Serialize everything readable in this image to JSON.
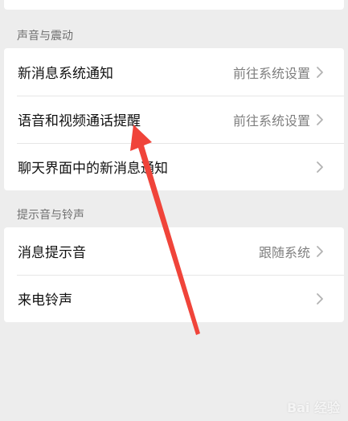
{
  "sections": [
    {
      "header": "声音与震动",
      "items": [
        {
          "label": "新消息系统通知",
          "value": "前往系统设置"
        },
        {
          "label": "语音和视频通话提醒",
          "value": "前往系统设置"
        },
        {
          "label": "聊天界面中的新消息通知",
          "value": ""
        }
      ]
    },
    {
      "header": "提示音与铃声",
      "items": [
        {
          "label": "消息提示音",
          "value": "跟随系统"
        },
        {
          "label": "来电铃声",
          "value": ""
        }
      ]
    }
  ],
  "icons": {
    "chevron": "chevron-right-icon",
    "annotation": "red-arrow-annotation"
  },
  "colors": {
    "background": "#ededed",
    "card": "#ffffff",
    "label": "#111111",
    "value": "#7f7f7f",
    "header": "#6f6f6f",
    "annotation": "#f0443a"
  },
  "watermark": {
    "text": "Bai 经验"
  }
}
